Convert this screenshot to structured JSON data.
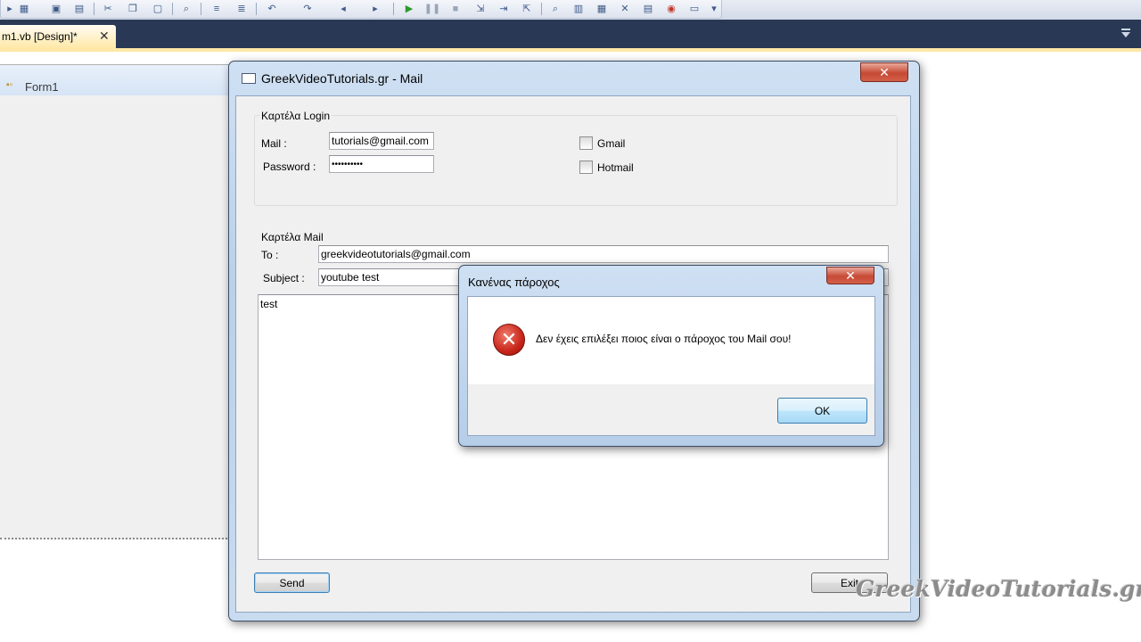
{
  "ide": {
    "document_tab": "m1.vb [Design]*",
    "tab_close": "✕",
    "designer_form_label": "Form1"
  },
  "mail_form": {
    "title": "GreekVideoTutorials.gr - Mail",
    "close_glyph": "✕",
    "login_group": {
      "label": "Καρτέλα Login",
      "mail_label": "Mail :",
      "mail_value": "tutorials@gmail.com",
      "password_label": "Password :",
      "password_value": "••••••••••",
      "gmail_label": "Gmail",
      "hotmail_label": "Hotmail"
    },
    "mail_group": {
      "label": "Καρτέλα Mail",
      "to_label": "To :",
      "to_value": "greekvideotutorials@gmail.com",
      "subject_label": "Subject :",
      "subject_value": "youtube test",
      "body_value": "test"
    },
    "send_label": "Send",
    "exit_label": "Exit"
  },
  "message_box": {
    "title": "Κανένας πάροχος",
    "close_glyph": "✕",
    "icon": "error-icon",
    "message": "Δεν έχεις επιλέξει ποιος είναι ο πάροχος του Mail σου!",
    "ok_label": "OK"
  },
  "watermark": "GreekVideoTutorials.gr",
  "colors": {
    "tab_strip": "#293955",
    "active_tab": "#ffe8a6",
    "error_red": "#c8261b",
    "close_button": "#c74a35"
  }
}
